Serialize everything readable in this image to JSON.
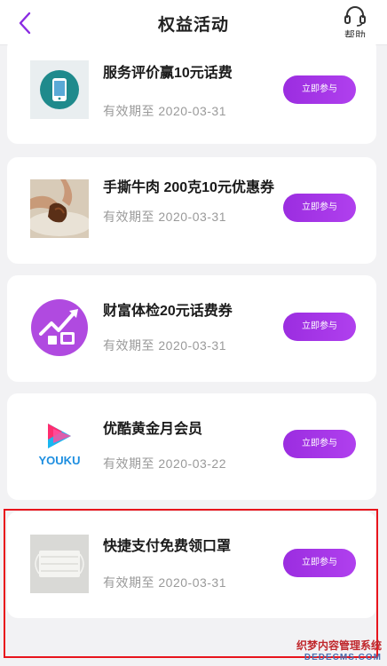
{
  "header": {
    "title": "权益活动",
    "help_label": "帮助"
  },
  "cards": [
    {
      "title": "服务评价赢10元话费",
      "expiry": "有效期至 2020-03-31",
      "button": "立即参与",
      "thumb_icon": "phone-icon"
    },
    {
      "title": "手撕牛肉 200克10元优惠券",
      "expiry": "有效期至 2020-03-31",
      "button": "立即参与",
      "thumb_icon": "beef-jerky-image"
    },
    {
      "title": "财富体检20元话费券",
      "expiry": "有效期至 2020-03-31",
      "button": "立即参与",
      "thumb_icon": "growth-chart-icon"
    },
    {
      "title": "优酷黄金月会员",
      "expiry": "有效期至 2020-03-22",
      "button": "立即参与",
      "thumb_icon": "youku-logo",
      "logo_text": "YOUKU"
    },
    {
      "title": "快捷支付免费领口罩",
      "expiry": "有效期至 2020-03-31",
      "button": "立即参与",
      "thumb_icon": "face-mask-image"
    }
  ],
  "colors": {
    "accent": "#a535e8",
    "highlight_border": "#e8141c"
  },
  "watermark": {
    "line1": "织梦内容管理系统",
    "line2": "DEDECMS.COM"
  }
}
